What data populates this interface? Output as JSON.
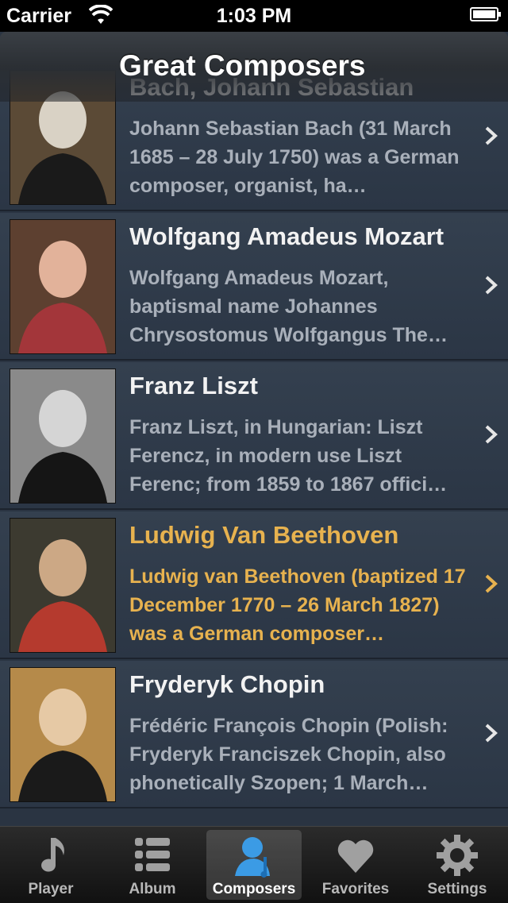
{
  "status": {
    "carrier": "Carrier",
    "time": "1:03 PM"
  },
  "nav": {
    "title": "Great Composers"
  },
  "composers": [
    {
      "name": "Bach, Johann Sebastian",
      "desc": "Johann Sebastian Bach (31 March 1685 – 28 July 1750) was a German composer, organist, ha…",
      "portrait_colors": [
        "#5b4a36",
        "#d9d2c5",
        "#1a1a1a"
      ]
    },
    {
      "name": "Wolfgang Amadeus Mozart",
      "desc": "Wolfgang Amadeus Mozart, baptismal name Johannes Chrysostomus Wolfgangus The…",
      "portrait_colors": [
        "#5d4030",
        "#e2b29a",
        "#a3363a"
      ]
    },
    {
      "name": "Franz Liszt",
      "desc": "Franz Liszt, in Hungarian: Liszt Ferencz, in modern use Liszt Ferenc; from 1859 to 1867 offici…",
      "portrait_colors": [
        "#8a8a8a",
        "#d5d5d5",
        "#151515"
      ]
    },
    {
      "name": "Ludwig Van Beethoven",
      "desc": "Ludwig van Beethoven (baptized 17 December 1770 – 26 March 1827) was a German composer…",
      "portrait_colors": [
        "#3c3a30",
        "#cca885",
        "#b53a2e"
      ]
    },
    {
      "name": "Fryderyk Chopin",
      "desc": "Frédéric François Chopin (Polish: Fryderyk Franciszek Chopin, also phonetically Szopen; 1 March…",
      "portrait_colors": [
        "#b58a4a",
        "#e6c9a5",
        "#1a1a1a"
      ]
    }
  ],
  "highlighted_index": 3,
  "tabs": [
    {
      "label": "Player",
      "icon": "music-note-icon"
    },
    {
      "label": "Album",
      "icon": "list-icon"
    },
    {
      "label": "Composers",
      "icon": "composer-icon",
      "active": true
    },
    {
      "label": "Favorites",
      "icon": "heart-icon"
    },
    {
      "label": "Settings",
      "icon": "gear-icon"
    }
  ],
  "colors": {
    "highlight_text": "#e7b24f",
    "active_composer_icon": "#3b9be5"
  }
}
